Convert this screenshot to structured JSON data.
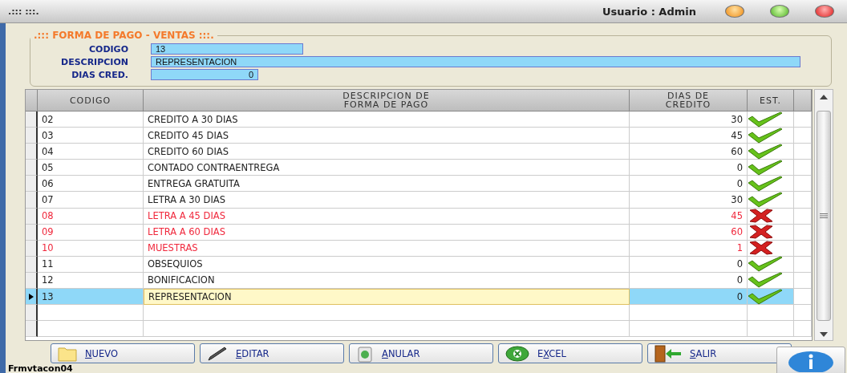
{
  "window": {
    "title": ".::: :::.",
    "user": "Usuario : Admin"
  },
  "form": {
    "legend": ".::: FORMA DE PAGO - VENTAS :::.",
    "fields": [
      {
        "label": "CODIGO",
        "value": "13",
        "kind": "short"
      },
      {
        "label": "DESCRIPCION",
        "value": "REPRESENTACION",
        "kind": "wide"
      },
      {
        "label": "DIAS CRED.",
        "value": "0",
        "kind": "number"
      }
    ]
  },
  "table": {
    "columns": [
      "CODIGO",
      "DESCRIPCION DE FORMA DE PAGO",
      "DIAS DE CREDITO",
      "EST."
    ],
    "rows": [
      {
        "codigo": "02",
        "descripcion": "CREDITO A 30 DIAS",
        "dias": "30",
        "active": true,
        "selected": false
      },
      {
        "codigo": "03",
        "descripcion": "CREDITO 45 DIAS",
        "dias": "45",
        "active": true,
        "selected": false
      },
      {
        "codigo": "04",
        "descripcion": "CREDITO 60 DIAS",
        "dias": "60",
        "active": true,
        "selected": false
      },
      {
        "codigo": "05",
        "descripcion": "CONTADO CONTRAENTREGA",
        "dias": "0",
        "active": true,
        "selected": false
      },
      {
        "codigo": "06",
        "descripcion": "ENTREGA GRATUITA",
        "dias": "0",
        "active": true,
        "selected": false
      },
      {
        "codigo": "07",
        "descripcion": "LETRA A 30 DIAS",
        "dias": "30",
        "active": true,
        "selected": false
      },
      {
        "codigo": "08",
        "descripcion": "LETRA A 45 DIAS",
        "dias": "45",
        "active": false,
        "selected": false
      },
      {
        "codigo": "09",
        "descripcion": "LETRA A 60 DIAS",
        "dias": "60",
        "active": false,
        "selected": false
      },
      {
        "codigo": "10",
        "descripcion": "MUESTRAS",
        "dias": "1",
        "active": false,
        "selected": false
      },
      {
        "codigo": "11",
        "descripcion": "OBSEQUIOS",
        "dias": "0",
        "active": true,
        "selected": false
      },
      {
        "codigo": "12",
        "descripcion": "BONIFICACION",
        "dias": "0",
        "active": true,
        "selected": false
      },
      {
        "codigo": "13",
        "descripcion": "REPRESENTACION",
        "dias": "0",
        "active": true,
        "selected": true
      }
    ]
  },
  "buttons": [
    {
      "kind": "new",
      "key": "N",
      "after": "UEVO"
    },
    {
      "kind": "edit",
      "key": "E",
      "after": "DITAR"
    },
    {
      "kind": "void",
      "key": "A",
      "after": "NULAR"
    },
    {
      "kind": "excel",
      "before": "E",
      "key": "X",
      "after": "CEL"
    },
    {
      "kind": "exit",
      "key": "S",
      "after": "ALIR"
    }
  ],
  "status_bar": "Frmvtacon04"
}
